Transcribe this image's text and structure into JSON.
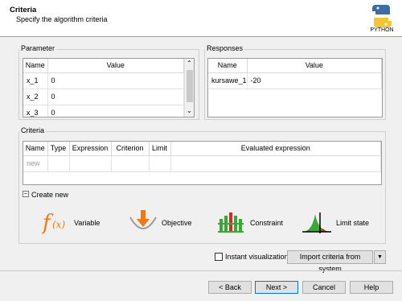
{
  "header": {
    "title": "Criteria",
    "subtitle": "Specify the algorithm criteria",
    "logo_text": "PYTHON"
  },
  "parameter": {
    "label": "Parameter",
    "columns": [
      "Name",
      "Value"
    ],
    "rows": [
      {
        "name": "x_1",
        "value": "0"
      },
      {
        "name": "x_2",
        "value": "0"
      },
      {
        "name": "x_3",
        "value": "0"
      }
    ]
  },
  "responses": {
    "label": "Responses",
    "columns": [
      "Name",
      "Value"
    ],
    "rows": [
      {
        "name": "kursawe_1",
        "value": "-20"
      }
    ]
  },
  "criteria": {
    "label": "Criteria",
    "columns": [
      "Name",
      "Type",
      "Expression",
      "Criterion",
      "Limit",
      "Evaluated expression"
    ],
    "new_row": "new"
  },
  "create_new": {
    "label": "Create new",
    "toggle": "−",
    "items": [
      {
        "label": "Variable",
        "icon": "fx-icon"
      },
      {
        "label": "Objective",
        "icon": "objective-icon"
      },
      {
        "label": "Constraint",
        "icon": "constraint-icon"
      },
      {
        "label": "Limit state",
        "icon": "limit-state-icon"
      }
    ]
  },
  "options": {
    "instant_visualization": "Instant visualization",
    "import_label": "Import criteria from system"
  },
  "buttons": {
    "back": "< Back",
    "next": "Next >",
    "cancel": "Cancel",
    "help": "Help"
  },
  "colors": {
    "accent": "#0078d7",
    "orange": "#f07a10",
    "green": "#3aa835",
    "red": "#d42a2a"
  }
}
